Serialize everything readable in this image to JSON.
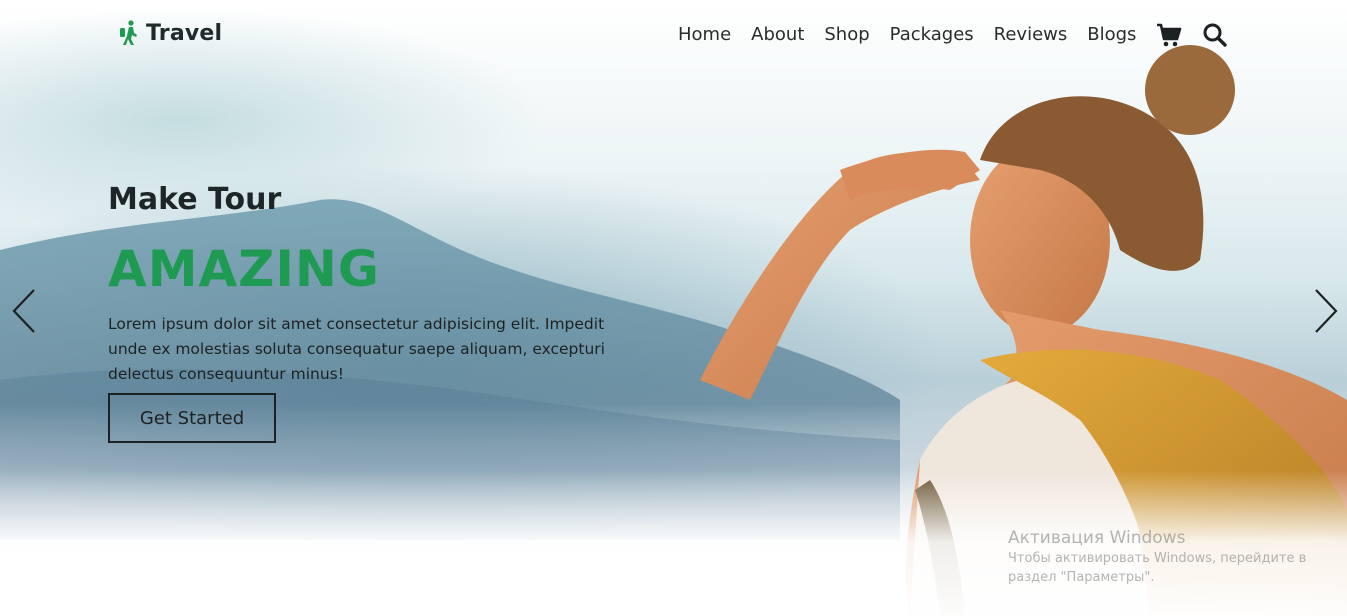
{
  "brand": {
    "name": "Travel",
    "icon": "hiker-icon",
    "accent": "#1f9a52"
  },
  "nav": {
    "items": [
      "Home",
      "About",
      "Shop",
      "Packages",
      "Reviews",
      "Blogs"
    ],
    "icons": [
      "cart-icon",
      "search-icon"
    ]
  },
  "hero": {
    "subtitle": "Make Tour",
    "title": "AMAZING",
    "description": "Lorem ipsum dolor sit amet consectetur adipisicing elit. Impedit unde ex molestias soluta consequatur saepe aliquam, excepturi delectus consequuntur minus!",
    "button_label": "Get Started",
    "prev_icon": "chevron-left-icon",
    "next_icon": "chevron-right-icon"
  },
  "watermark": {
    "title": "Активация Windows",
    "line1": "Чтобы активировать Windows, перейдите в",
    "line2": "раздел \"Параметры\"."
  }
}
